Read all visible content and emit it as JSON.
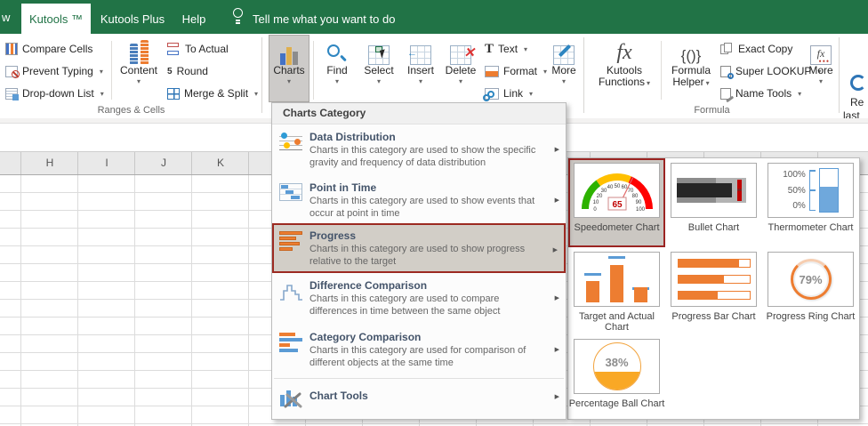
{
  "colors": {
    "excel_green": "#217346",
    "accent_orange": "#ED7D31",
    "accent_blue": "#5B9BD5",
    "selection_border": "#9B2422",
    "selection_bg": "#D2CEC7"
  },
  "icons": {
    "caret": "▾",
    "arrow_right": "▶",
    "text_glyph": "T",
    "fx": "fx",
    "braces": "{()}",
    "round_glyph": "5",
    "delete_x": "✕",
    "insert_arrow": "←"
  },
  "tabbar": {
    "partial_tab": "w",
    "active_tab": "Kutools ™",
    "tab_plus": "Kutools Plus",
    "tab_help": "Help",
    "tell_me": "Tell me what you want to do"
  },
  "ribbon": {
    "group1": {
      "label": "Ranges & Cells",
      "compare_cells": "Compare Cells",
      "prevent_typing": "Prevent Typing",
      "dropdown_list": "Drop-down List",
      "content": "Content",
      "to_actual": "To Actual",
      "round": "Round",
      "merge_split": "Merge & Split"
    },
    "group2": {
      "charts": "Charts",
      "find": "Find",
      "select": "Select",
      "insert": "Insert",
      "delete": "Delete",
      "text": "Text",
      "format": "Format",
      "link": "Link",
      "more": "More"
    },
    "group3": {
      "label": "Formula",
      "kutools_line1": "Kutools",
      "kutools_line2": "Functions",
      "helper_line1": "Formula",
      "helper_line2": "Helper",
      "exact_copy": "Exact Copy",
      "super_lookup": "Super LOOKUP",
      "name_tools": "Name Tools",
      "more": "More"
    },
    "group4": {
      "label": "Re",
      "line1": "Re",
      "line2": "last"
    }
  },
  "sheet": {
    "columns": [
      "H",
      "I",
      "J",
      "K"
    ]
  },
  "menu": {
    "header": "Charts Category",
    "items": [
      {
        "title": "Data Distribution",
        "desc": "Charts in this category are used to show the specific gravity and frequency of data distribution"
      },
      {
        "title": "Point in Time",
        "desc": "Charts in this category are used to show events that occur at point in time"
      },
      {
        "title": "Progress",
        "desc": "Charts in this category are used to show progress relative to the target"
      },
      {
        "title": "Difference Comparison",
        "desc": "Charts in this category are used to compare differences in time between the same object"
      },
      {
        "title": "Category Comparison",
        "desc": "Charts in this category are used for comparison of different objects at the same time"
      },
      {
        "title": "Chart Tools"
      }
    ]
  },
  "flyout": {
    "tiles": [
      {
        "label": "Speedometer Chart",
        "gauge": {
          "value": "65",
          "labels": [
            "0",
            "10",
            "20",
            "30",
            "40",
            "50",
            "60",
            "70",
            "80",
            "90",
            "100"
          ]
        }
      },
      {
        "label": "Bullet Chart"
      },
      {
        "label": "Thermometer Chart",
        "axis": [
          "100%",
          "50%",
          "0%"
        ]
      },
      {
        "label": "Target and Actual Chart"
      },
      {
        "label": "Progress Bar Chart"
      },
      {
        "label": "Progress Ring Chart",
        "value": "79%"
      },
      {
        "label": "Percentage Ball Chart",
        "value": "38%"
      }
    ]
  }
}
